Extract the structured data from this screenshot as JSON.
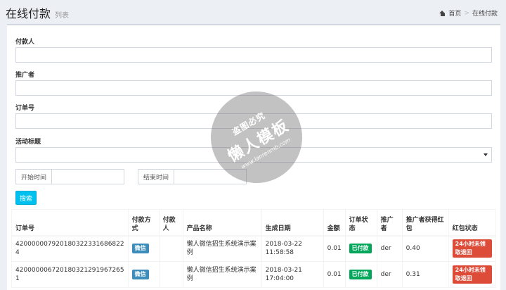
{
  "header": {
    "title": "在线付款",
    "subtitle": "列表",
    "breadcrumb": [
      "首页",
      "在线付款"
    ]
  },
  "form": {
    "payer_label": "付款人",
    "promoter_label": "推广者",
    "order_label": "订单号",
    "activity_label": "活动标题",
    "start_time_label": "开始时间",
    "end_time_label": "结束时间",
    "search_button": "搜索"
  },
  "table": {
    "headers": [
      "订单号",
      "付款方式",
      "付款人",
      "产品名称",
      "生成日期",
      "金额",
      "订单状态",
      "推广者",
      "推广者获得红包",
      "红包状态"
    ],
    "rows": [
      {
        "order": "420000007920180322331686822 4",
        "pay_method": "微信",
        "payer": "",
        "product": "懒人微信招生系统演示案例",
        "date": "2018-03-22 11:58:58",
        "amount": "0.01",
        "status": "已付款",
        "promoter": "der",
        "bonus": "0.40",
        "bonus_status": "24小时未领取退回"
      },
      {
        "order": "420000006720180321291967265 1",
        "pay_method": "微信",
        "payer": "",
        "product": "懒人微信招生系统演示案例",
        "date": "2018-03-21 17:04:00",
        "amount": "0.01",
        "status": "已付款",
        "promoter": "der",
        "bonus": "0.31",
        "bonus_status": "24小时未领取退回"
      }
    ]
  },
  "watermark": {
    "line1": "盗图必究",
    "line2": "懒人模板",
    "url": "www.lanrenmb.com"
  },
  "colors": {
    "accent": "#00c0ef",
    "wechat_tag": "#3c8dbc",
    "paid_tag": "#00a65a",
    "refund_tag": "#dd4b39"
  }
}
